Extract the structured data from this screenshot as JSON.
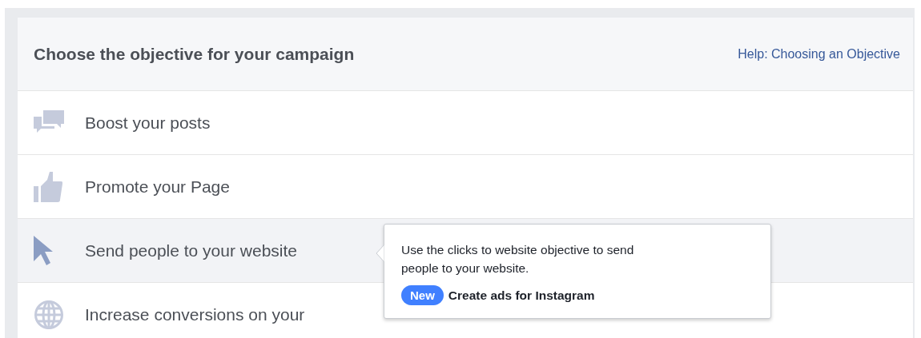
{
  "header": {
    "title": "Choose the objective for your campaign",
    "help_link": "Help: Choosing an Objective"
  },
  "objectives": [
    {
      "kind": "posts",
      "label": "Boost your posts",
      "selected": false
    },
    {
      "kind": "page",
      "label": "Promote your Page",
      "selected": false
    },
    {
      "kind": "website",
      "label": "Send people to your website",
      "selected": true
    },
    {
      "kind": "conversions",
      "label": "Increase conversions on your",
      "selected": false
    }
  ],
  "tooltip": {
    "text": "Use the clicks to website objective to send people to your website.",
    "badge": "New",
    "link": "Create ads for Instagram"
  }
}
